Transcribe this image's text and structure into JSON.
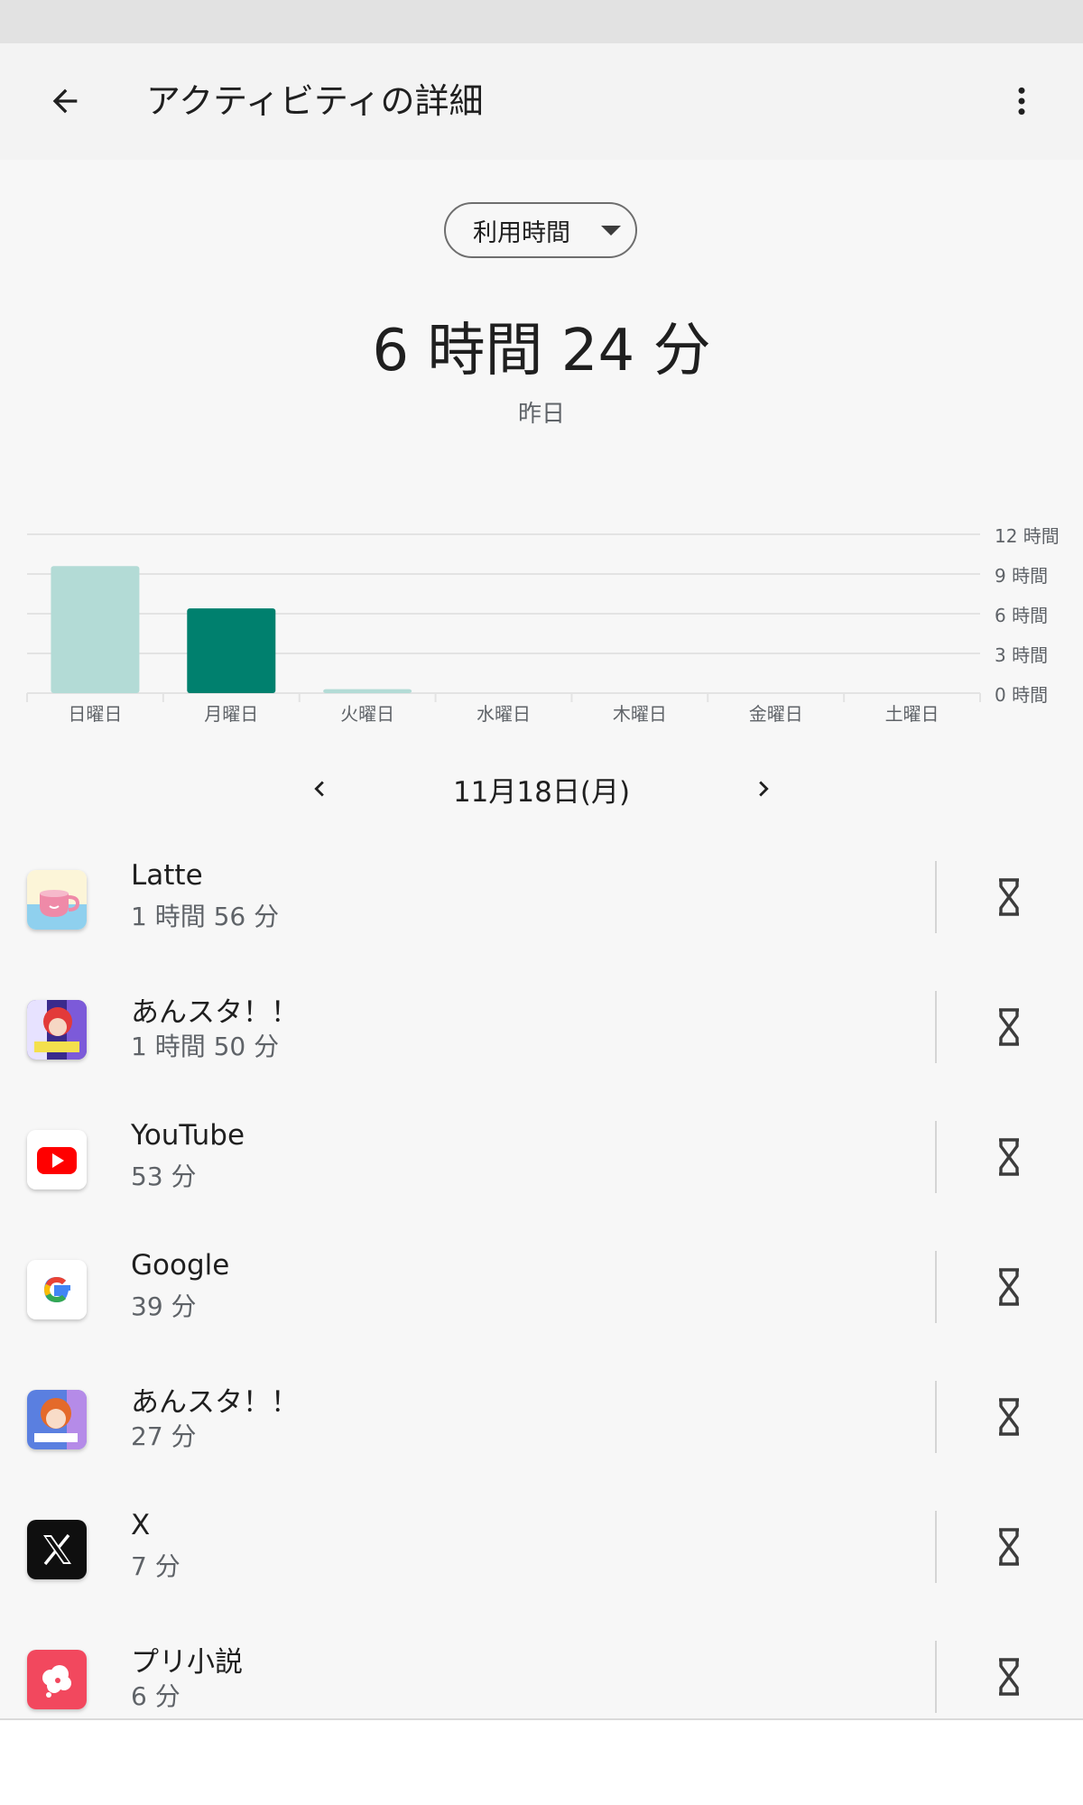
{
  "header": {
    "title": "アクティビティの詳細",
    "back_icon": "arrow-left-icon",
    "menu_icon": "more-vertical-icon"
  },
  "metric_selector": {
    "selected": "利用時間",
    "icon": "triangle-down-icon"
  },
  "summary": {
    "total": "6 時間 24 分",
    "day_label": "昨日"
  },
  "chart_data": {
    "type": "bar",
    "categories": [
      "日曜日",
      "月曜日",
      "火曜日",
      "水曜日",
      "木曜日",
      "金曜日",
      "土曜日"
    ],
    "values": [
      9.6,
      6.4,
      0.3,
      0,
      0,
      0,
      0
    ],
    "unit": "時間",
    "selected_index": 1,
    "ylim": [
      0,
      12
    ],
    "y_ticks": [
      "12 時間",
      "9 時間",
      "6 時間",
      "3 時間",
      "0 時間"
    ],
    "y_tick_values": [
      12,
      9,
      6,
      3,
      0
    ],
    "grid": true,
    "colors": {
      "selected": "#00806e",
      "other": "#b3dbd6",
      "grid": "#e3e3e3",
      "axis_text": "#5f6368"
    }
  },
  "date_nav": {
    "date": "11月18日(月)",
    "prev_icon": "chevron-left-icon",
    "next_icon": "chevron-right-icon"
  },
  "apps": [
    {
      "name": "Latte",
      "time": "1 時間 56 分",
      "icon": "latte-app-icon"
    },
    {
      "name": "あんスタ！！",
      "time": "1 時間 50 分",
      "icon": "ensemble-stars-music-app-icon"
    },
    {
      "name": "YouTube",
      "time": "53 分",
      "icon": "youtube-app-icon"
    },
    {
      "name": "Google",
      "time": "39 分",
      "icon": "google-app-icon"
    },
    {
      "name": "あんスタ！！",
      "time": "27 分",
      "icon": "ensemble-stars-basic-app-icon"
    },
    {
      "name": "X",
      "time": "7 分",
      "icon": "x-app-icon"
    },
    {
      "name": "プリ小説",
      "time": "6 分",
      "icon": "puri-shousetsu-app-icon"
    }
  ],
  "timer_icon": "hourglass-icon"
}
